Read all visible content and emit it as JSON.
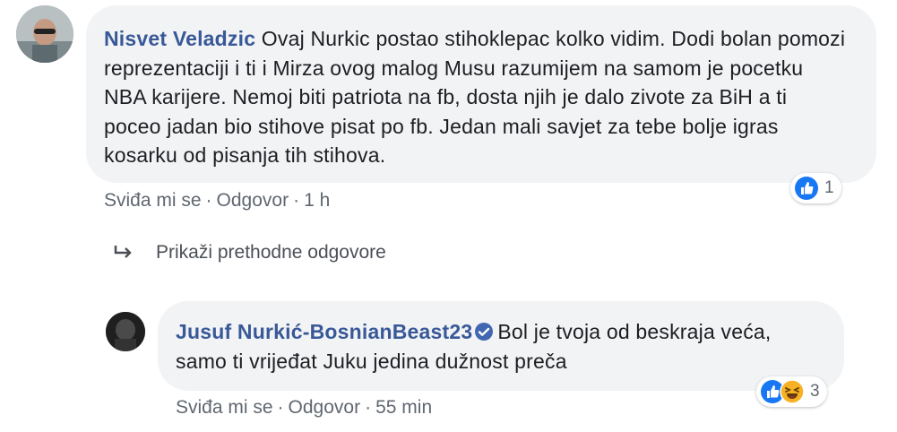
{
  "comment": {
    "author": "Nisvet Veladzic",
    "text": "Ovaj Nurkic postao stihoklepac kolko vidim. Dodi bolan pomozi reprezentaciji i ti i Mirza ovog malog Musu razumijem na samom je pocetku NBA karijere. Nemoj biti patriota na fb, dosta njih je dalo zivote za BiH a ti poceo jadan bio stihove pisat po fb. Jedan mali savjet za tebe bolje igras kosarku od pisanja tih stihova.",
    "like_label": "Sviđa mi se",
    "reply_label": "Odgovor",
    "time": "1 h",
    "reaction_count": "1",
    "reaction_icons": [
      "like-icon"
    ]
  },
  "previous_replies": {
    "label": "Prikaži prethodne odgovore"
  },
  "reply": {
    "author": "Jusuf Nurkić-BosnianBeast23",
    "verified": true,
    "text": "Bol je tvoja od beskraja veća, samo ti vrijeđat Juku jedina dužnost preča",
    "like_label": "Sviđa mi se",
    "reply_label": "Odgovor",
    "time": "55 min",
    "reaction_count": "3",
    "reaction_icons": [
      "like-icon",
      "haha-icon"
    ]
  },
  "colors": {
    "author": "#385898",
    "bubble": "#f2f3f5",
    "like_blue": "#1877f2",
    "haha_yellow": "#f7b125"
  }
}
